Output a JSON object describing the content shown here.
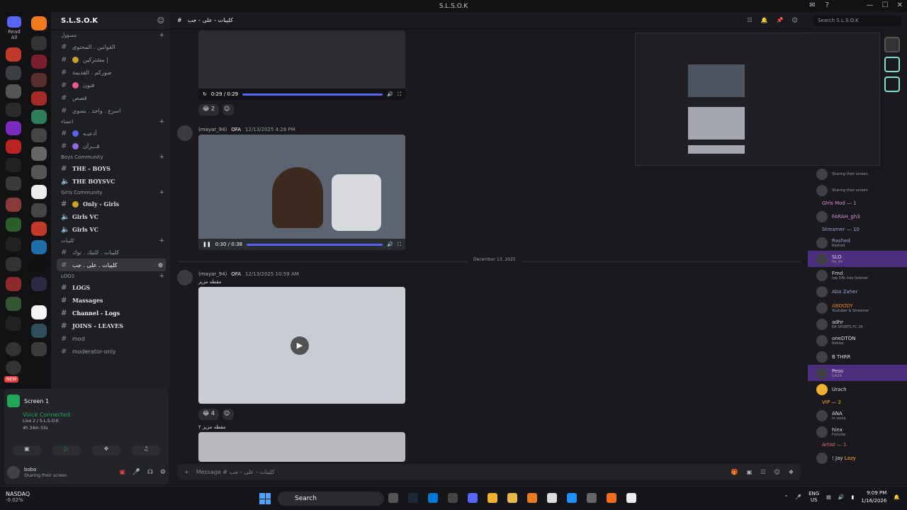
{
  "window": {
    "title": "S.L.S.O.K"
  },
  "sidebar": {
    "read_all": "Read All",
    "server_name": "S.L.S.O.K",
    "categories": [
      {
        "label": "مسؤول",
        "channels": [
          "القوانين . المحتوى",
          "مشتركين |",
          "صوركم . القديمة",
          "فنون",
          "قصص",
          "اسرع . واحد . يسوي"
        ]
      },
      {
        "label": "اعضاء",
        "channels": [
          "أذعيـه",
          "قـــرآن"
        ]
      },
      {
        "label": "Boys Community",
        "channels": [
          "THE - BOYS",
          "THE BOYSVC"
        ]
      },
      {
        "label": "Girls Community",
        "channels": [
          "Only - Girls",
          "Girls VC",
          "Girls VC"
        ]
      },
      {
        "label": "كليبات",
        "channels": [
          "كليبات . للتيك . توك",
          "كليبات . على . جب"
        ]
      },
      {
        "label": "LOGS",
        "channels": [
          "LOGS",
          "Massages",
          "Channel - Logs",
          "JOINS - LEAVES",
          "mod",
          "moderator-only"
        ]
      }
    ],
    "new_badge": "NEW"
  },
  "voice": {
    "screen_title": "Screen 1",
    "status": "Voice Connected",
    "channel": "Live 2 / S.L.S.O.K",
    "time": "4h 34m 33s",
    "user": "bobo",
    "user_status": "Sharing their screen"
  },
  "main": {
    "channel_name": "كليبات - على - جب",
    "search_placeholder": "Search S.L.S.O.K",
    "video1_time": "0:29 / 0:29",
    "reaction1_count": "2",
    "msg2_user": "(mayar_94)",
    "msg2_tag": "OFA",
    "msg2_time": "12/13/2025 4:26 PM",
    "video2_time": "0:30 / 0:38",
    "date_divider": "December 13, 2025",
    "msg3_user": "(mayar_94)",
    "msg3_tag": "OFA",
    "msg3_time": "12/13/2025 10:59 AM",
    "msg3_text": "مقطه مزيز",
    "reaction2_count": "4",
    "msg4_text": "مقطه مزيز ٢",
    "composer_placeholder": "Message # كليبات - على - جب"
  },
  "members": [
    {
      "name": "",
      "status": "Sharing their screen"
    },
    {
      "name": "",
      "status": "Sharing their screen"
    },
    {
      "cat": "Girls Mod — 1"
    },
    {
      "name": "FARAH_gh3",
      "status": ""
    },
    {
      "cat": "Streamer — 10"
    },
    {
      "name": "Rashed",
      "status": "Rashed"
    },
    {
      "name": "SLO",
      "status": "No_kh"
    },
    {
      "name": "Fmd",
      "status": "top 54k trav listener"
    },
    {
      "name": "Abo Zaher",
      "status": ""
    },
    {
      "name": "ABOODY",
      "status": "Youtuber & Streamer"
    },
    {
      "name": "adhr",
      "status": "EA SPORTS FC 26"
    },
    {
      "name": "oneDTON",
      "status": "Roblox"
    },
    {
      "name": "B THRR",
      "status": ""
    },
    {
      "name": "Peso",
      "status": "GAZA"
    },
    {
      "name": "Urach",
      "status": ""
    },
    {
      "cat": "VIP — 2"
    },
    {
      "name": "ANA",
      "status": "In voice"
    },
    {
      "name": "hinx",
      "status": "Fortnite"
    },
    {
      "cat": "Artist — 1"
    },
    {
      "name": "! Jay",
      "status": "Lazy"
    }
  ],
  "taskbar": {
    "ticker": "NASDAQ",
    "ticker_value": "-0.02%",
    "search": "Search",
    "lang": "ENG",
    "region": "US",
    "time": "9:09 PM",
    "date": "1/16/2026"
  },
  "colors": {
    "accent": "#5865f2",
    "online": "#23a55a",
    "highlight": "#4b2e7d"
  }
}
